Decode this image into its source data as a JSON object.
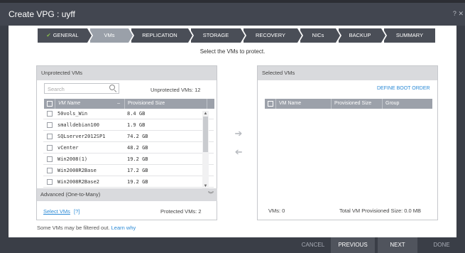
{
  "window": {
    "title": "Create VPG : uyff",
    "help_icon": "?",
    "close_icon": "✕"
  },
  "steps": [
    {
      "label": "GENERAL",
      "done": true
    },
    {
      "label": "VMs",
      "active": true
    },
    {
      "label": "REPLICATION"
    },
    {
      "label": "STORAGE"
    },
    {
      "label": "RECOVERY"
    },
    {
      "label": "NICs"
    },
    {
      "label": "BACKUP"
    },
    {
      "label": "SUMMARY"
    }
  ],
  "instruction": "Select the VMs to protect.",
  "unprotected": {
    "title": "Unprotected VMs",
    "search_placeholder": "Search",
    "count_text": "Unprotected VMs: 12",
    "columns": {
      "name": "VM Name",
      "size": "Provisioned Size"
    },
    "rows": [
      {
        "name": "50vols_Win",
        "size": "8.4 GB"
      },
      {
        "name": "smalldebian100",
        "size": "1.9 GB"
      },
      {
        "name": "SQLserver2012SP1",
        "size": "74.2 GB"
      },
      {
        "name": "vCenter",
        "size": "48.2 GB"
      },
      {
        "name": "Win2008(1)",
        "size": "19.2 GB"
      },
      {
        "name": "Win2008R2Base",
        "size": "17.2 GB"
      },
      {
        "name": "Win2008R2Base2",
        "size": "19.2 GB"
      }
    ],
    "advanced_label": "Advanced (One-to-Many)",
    "select_vms_link": "Select VMs",
    "help_link": "[?]",
    "protected_count": "Protected VMs: 2"
  },
  "filtered_note": {
    "text": "Some VMs may be filtered out.",
    "link": "Learn why"
  },
  "selected": {
    "title": "Selected VMs",
    "define_boot_order": "DEFINE BOOT ORDER",
    "columns": {
      "name": "VM Name",
      "size": "Provisioned Size",
      "group": "Group"
    },
    "vms_count": "VMs: 0",
    "total_size": "Total VM Provisioned Size: 0.0 MB"
  },
  "footer": {
    "cancel": "CANCEL",
    "previous": "PREVIOUS",
    "next": "NEXT",
    "done": "DONE"
  },
  "colors": {
    "title_bar": "#424650",
    "step_active": "#9aa0a9",
    "step_inactive": "#4a4e57",
    "table_header": "#9ca1aa",
    "link": "#2b8ad6",
    "check": "#8bc34a"
  }
}
